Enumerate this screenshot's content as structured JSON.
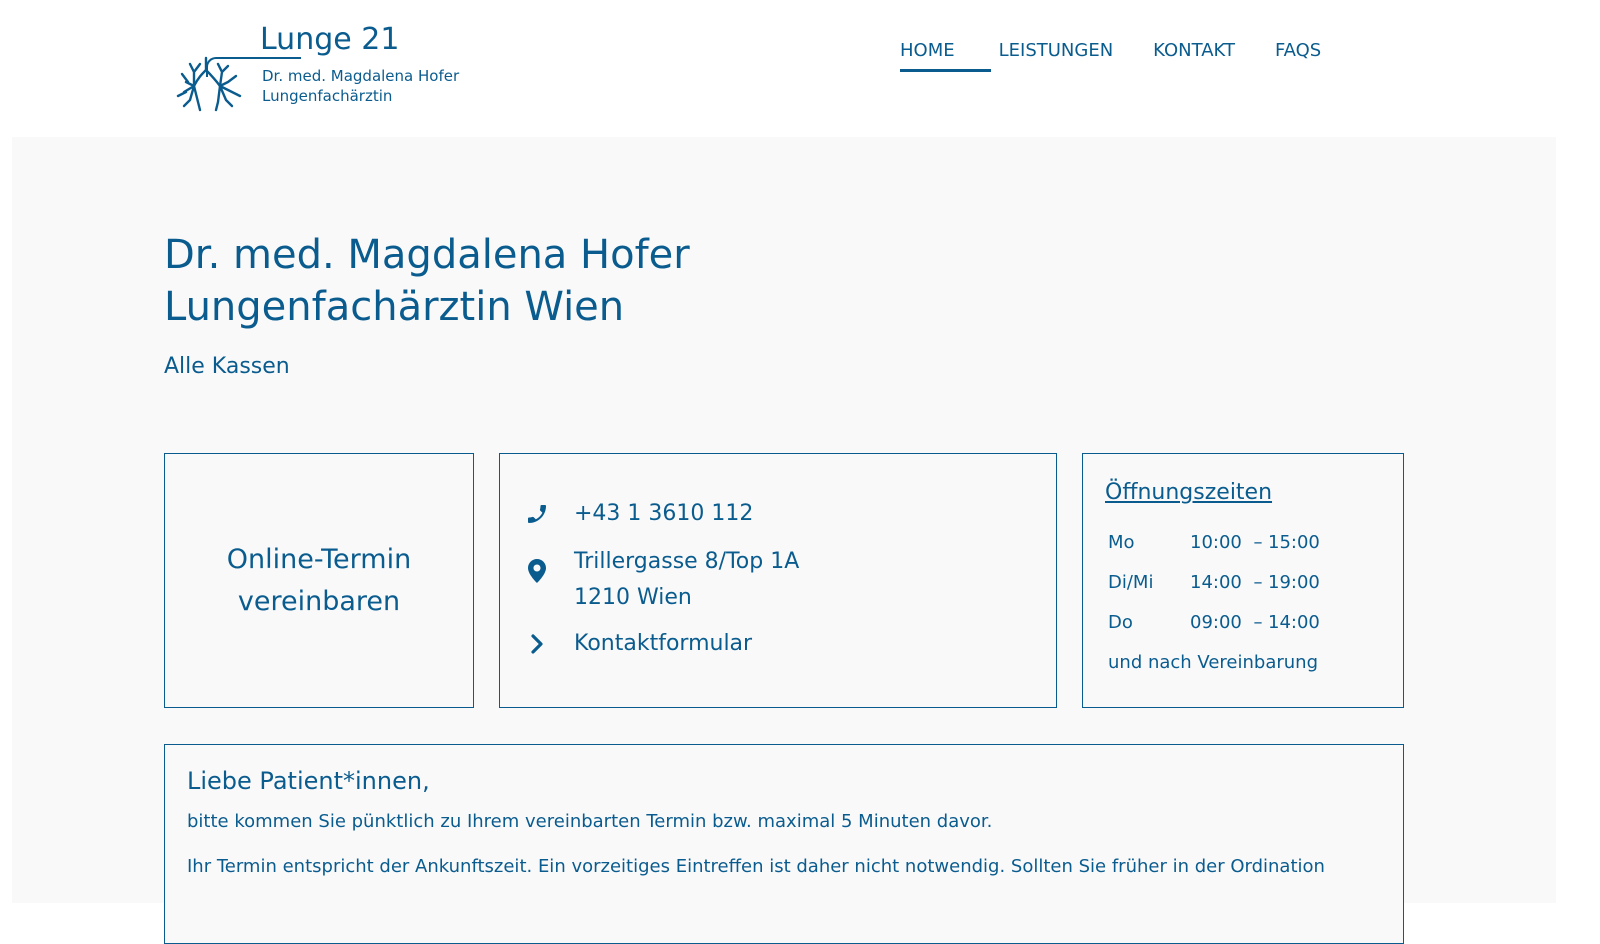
{
  "logo": {
    "title": "Lunge 21",
    "line1": "Dr. med. Magdalena Hofer",
    "line2": "Lungenfachärztin",
    "icon": "lungs-icon"
  },
  "nav": {
    "items": [
      {
        "label": "HOME",
        "active": true
      },
      {
        "label": "LEISTUNGEN",
        "active": false
      },
      {
        "label": "KONTAKT",
        "active": false
      },
      {
        "label": "FAQS",
        "active": false
      }
    ]
  },
  "hero": {
    "title_line1": "Dr. med. Magdalena Hofer",
    "title_line2": "Lungenfachärztin Wien",
    "subtitle": "Alle Kassen"
  },
  "termin": {
    "label": "Online-Termin vereinbaren"
  },
  "contact": {
    "phone": "+43 1 3610 112",
    "address_line1": "Trillergasse 8/Top 1A",
    "address_line2": "1210 Wien",
    "form_link": "Kontaktformular",
    "icons": [
      "phone-icon",
      "location-pin-icon",
      "chevron-right-icon"
    ]
  },
  "hours": {
    "title": "Öffnungszeiten",
    "rows": [
      {
        "day": "Mo",
        "from": "10:00",
        "to": "15:00"
      },
      {
        "day": "Di/Mi",
        "from": "14:00",
        "to": "19:00"
      },
      {
        "day": "Do",
        "from": "09:00",
        "to": "14:00"
      }
    ],
    "separator": "–",
    "note": "und nach Vereinbarung"
  },
  "notice": {
    "title": "Liebe Patient*innen,",
    "p1": "bitte kommen Sie pünktlich zu Ihrem vereinbarten Termin bzw. maximal 5 Minuten davor.",
    "p2": "Ihr Termin entspricht der Ankunftszeit. Ein vorzeitiges Eintreffen ist daher nicht notwendig. Sollten Sie früher in der Ordination"
  },
  "colors": {
    "brand": "#0b5c8e",
    "background": "#f9f9fa"
  }
}
